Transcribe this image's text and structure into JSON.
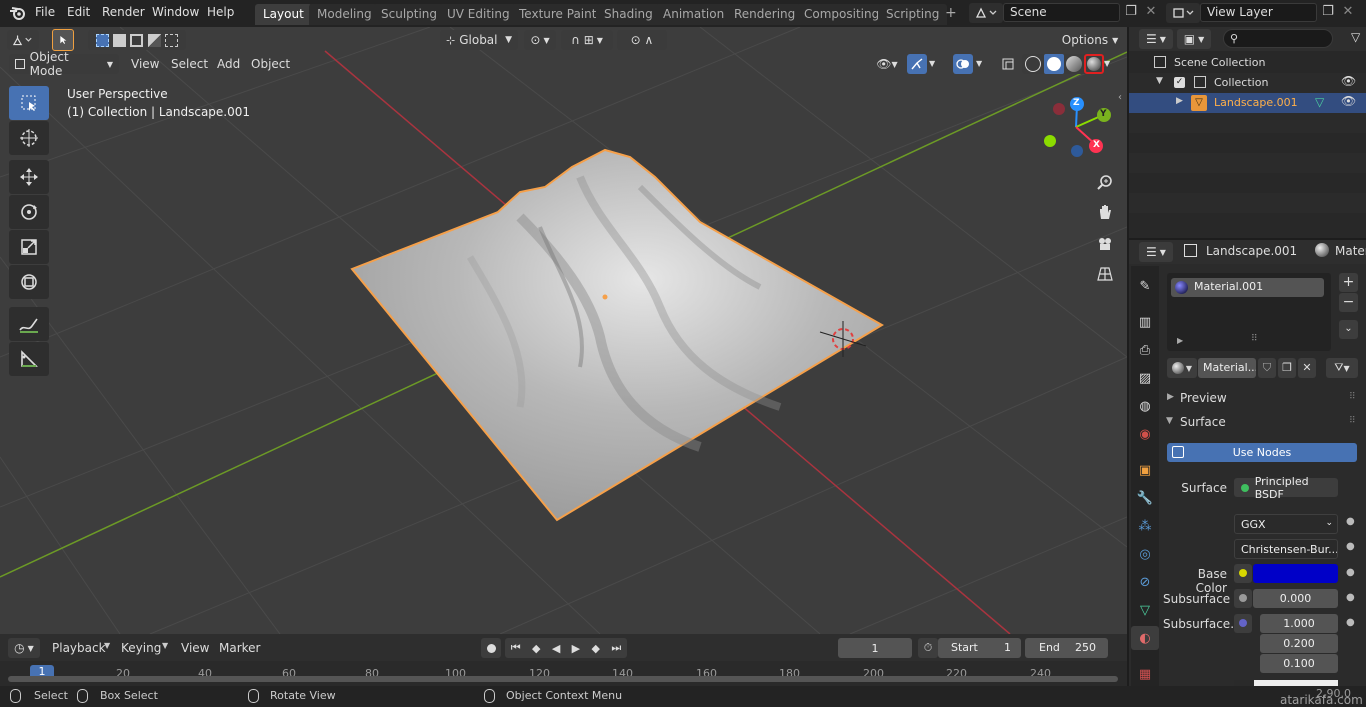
{
  "topbar": {
    "menus": [
      "File",
      "Edit",
      "Render",
      "Window",
      "Help"
    ],
    "workspaces": [
      "Layout",
      "Modeling",
      "Sculpting",
      "UV Editing",
      "Texture Paint",
      "Shading",
      "Animation",
      "Rendering",
      "Compositing",
      "Scripting"
    ],
    "active_workspace": "Layout",
    "add_tab": "+",
    "scene": "Scene",
    "view_layer": "View Layer"
  },
  "viewport_header": {
    "orientation": "Global",
    "options": "Options",
    "mode": "Object Mode",
    "menus": [
      "View",
      "Select",
      "Add",
      "Object"
    ]
  },
  "viewport": {
    "perspective": "User Perspective",
    "collection_info": "(1) Collection | Landscape.001",
    "gizmo_axes": {
      "z": "Z",
      "y": "Y",
      "x": "X"
    },
    "colors": {
      "x": "#ff3352",
      "y": "#8bdc00",
      "z": "#2890ff",
      "selection": "#f5a04a"
    }
  },
  "outliner": {
    "scene_collection": "Scene Collection",
    "collection": "Collection",
    "object": "Landscape.001"
  },
  "properties": {
    "object_name": "Landscape.001",
    "tab_label": "Mater",
    "material_slot": "Material.001",
    "material_name": "Material...",
    "sections": {
      "preview": "Preview",
      "surface": "Surface"
    },
    "use_nodes": "Use Nodes",
    "surface_label": "Surface",
    "surface_shader": "Principled BSDF",
    "distribution": "GGX",
    "subsurface_method": "Christensen-Bur...",
    "base_color_label": "Base Color",
    "base_color": "#0000c8",
    "subsurface_label": "Subsurface",
    "subsurface_value": "0.000",
    "subsurface_radius_label": "Subsurface...",
    "subsurface_radius": [
      "1.000",
      "0.200",
      "0.100"
    ]
  },
  "timeline": {
    "menus": [
      "Playback",
      "Keying",
      "View",
      "Marker"
    ],
    "current_frame": "1",
    "start_label": "Start",
    "start": "1",
    "end_label": "End",
    "end": "250",
    "ticks": [
      "1",
      "20",
      "40",
      "60",
      "80",
      "100",
      "120",
      "140",
      "160",
      "180",
      "200",
      "220",
      "240"
    ]
  },
  "statusbar": {
    "select": "Select",
    "box_select": "Box Select",
    "rotate_view": "Rotate View",
    "context_menu": "Object Context Menu",
    "version": "2.90.0",
    "watermark": "atarikafa.com"
  }
}
